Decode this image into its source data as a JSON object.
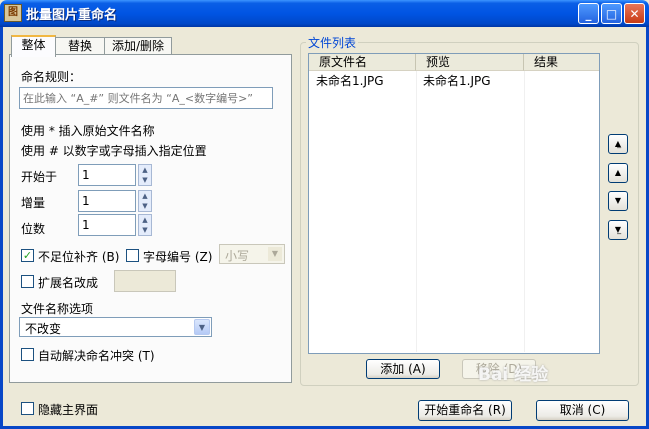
{
  "window": {
    "title": "批量图片重命名",
    "icon_name": "app-icon",
    "icon_glyph": "图"
  },
  "tabs": [
    {
      "label": "整体"
    },
    {
      "label": "替换"
    },
    {
      "label": "添加/删除"
    }
  ],
  "left": {
    "naming_rule_label": "命名规则：",
    "naming_rule_placeholder": "在此输入 “A_#” 则文件名为 “A_<数字编号>”",
    "hint_star": "使用 * 插入原始文件名称",
    "hint_hash": "使用 # 以数字或字母插入指定位置",
    "start_label": "开始于",
    "start_value": "1",
    "increment_label": "增量",
    "increment_value": "1",
    "digits_label": "位数",
    "digits_value": "1",
    "pad_label": "不足位补齐 (B)",
    "pad_checked": true,
    "letter_label": "字母编号 (Z)",
    "letter_checked": false,
    "case_value": "小写",
    "ext_label": "扩展名改成",
    "ext_checked": false,
    "ext_value": "",
    "filename_options_label": "文件名称选项",
    "filename_option_value": "不改变",
    "auto_conflict_label": "自动解决命名冲突 (T)",
    "auto_conflict_checked": false
  },
  "file_list": {
    "group_label": "文件列表",
    "columns": [
      "原文件名",
      "预览",
      "结果"
    ],
    "rows": [
      {
        "original": "未命名1.JPG",
        "preview": "未命名1.JPG",
        "result": ""
      }
    ],
    "add_button": "添加 (A)",
    "remove_button": "移除 (D)"
  },
  "bottom": {
    "hide_main_label": "隐藏主界面",
    "hide_main_checked": false,
    "start_button": "开始重命名 (R)",
    "cancel_button": "取消 (C)"
  },
  "watermark": "Bai 经验"
}
